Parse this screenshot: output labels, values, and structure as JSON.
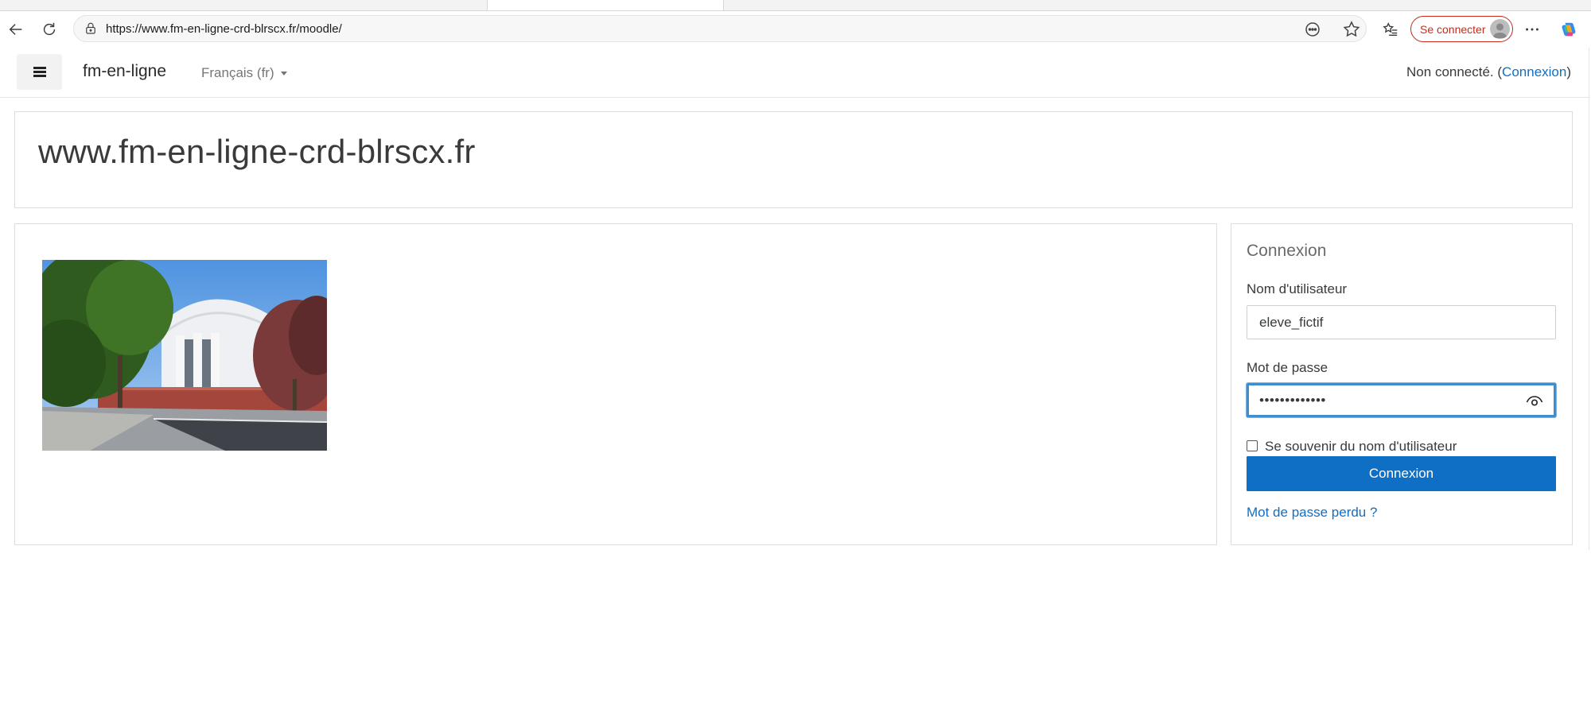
{
  "browser": {
    "url": "https://www.fm-en-ligne-crd-blrscx.fr/moodle/",
    "signin_label": "Se connecter",
    "icons": [
      "back-arrow-icon",
      "refresh-icon",
      "lock-icon",
      "reader-mode-icon",
      "favorite-star-icon",
      "favorites-list-icon",
      "profile-avatar-icon",
      "more-menu-icon",
      "copilot-icon"
    ]
  },
  "navbar": {
    "brand": "fm-en-ligne",
    "language": "Français ‎(fr)‎",
    "not_logged_in": "Non connecté. (",
    "login_link": "Connexion",
    "closing_paren": ")"
  },
  "header": {
    "site_title": "www.fm-en-ligne-crd-blrscx.fr"
  },
  "login": {
    "title": "Connexion",
    "username_label": "Nom d'utilisateur",
    "username_value": "eleve_fictif",
    "password_label": "Mot de passe",
    "password_value": "•••••••••••••",
    "remember_label": "Se souvenir du nom d'utilisateur",
    "remember_checked": false,
    "submit_label": "Connexion",
    "lost_password": "Mot de passe perdu ?"
  },
  "colors": {
    "primary": "#0f6fc5",
    "signin_red": "#c42b1c",
    "focus_ring": "#3d8ecc"
  }
}
